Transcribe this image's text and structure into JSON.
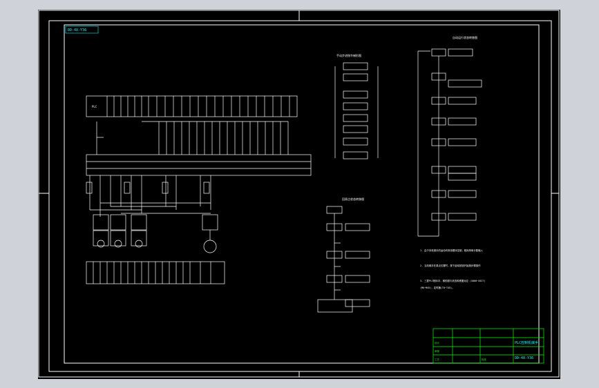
{
  "drawing": {
    "code_tag": "DD-4X-Y36",
    "plc_box_label": "PLC",
    "ladder_titles": {
      "left": "手动步进指令梯形图",
      "main": "自动运行状态转移图",
      "lower": "回原点状态转移图"
    },
    "notes": [
      "1. 由于本机械手的运动均采用顺序控制，程序简单分配输入",
      "2. 当机械手在原点位置时，按下起动按钮开始按步骤操作",
      "3. 三菱PLC程序中，梯形图与状态转移图对应 (X000~X027)",
      "(M0~M45)，定时器(T0~T45)。"
    ],
    "title_block": {
      "drawing_title": "PLC控制机械手",
      "drawing_no": "DD-4X-Y36",
      "rows": [
        "设计",
        "审核",
        "工艺",
        "批准"
      ]
    }
  },
  "colors": {
    "background": "#000000",
    "frame": "#ffffff",
    "title_block": "#00ff00",
    "accent": "#00ffff"
  }
}
